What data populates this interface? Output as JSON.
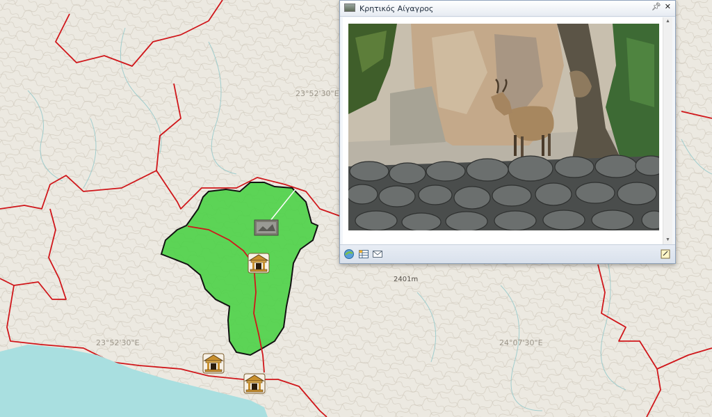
{
  "map": {
    "coordinate_labels": [
      "23°52'30\"E",
      "23°52'30\"E",
      "24°07'30\"E"
    ],
    "elevation_label": "2401m",
    "colors": {
      "land": "#ece9e1",
      "sea": "#a9dfe0",
      "area_fill": "#4fd14a",
      "boundary": "#d0161a",
      "outline": "#111111"
    },
    "poi_icon": "temple-icon"
  },
  "popup": {
    "title": "Κρητικός Αίγαγρος",
    "pin_icon": "pin-icon",
    "close_icon": "close-icon",
    "photo_subject": "photo-of-cretan-wild-goat",
    "footer_icons": [
      "zoom-to-icon",
      "table-icon",
      "email-icon",
      "note-icon"
    ]
  }
}
